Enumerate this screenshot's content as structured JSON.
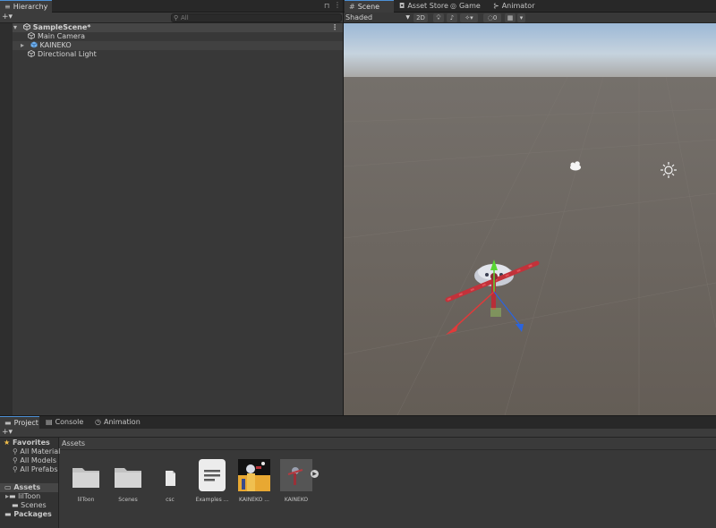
{
  "hierarchy": {
    "tab_label": "Hierarchy",
    "search_placeholder": "All",
    "scene_name": "SampleScene*",
    "items": [
      {
        "label": "Main Camera"
      },
      {
        "label": "KAINEKO"
      },
      {
        "label": "Directional Light"
      }
    ]
  },
  "scene_tabs": [
    {
      "label": "Scene",
      "icon": "grid-icon"
    },
    {
      "label": "Asset Store",
      "icon": "bag-icon"
    },
    {
      "label": "Game",
      "icon": "gamepad-icon"
    },
    {
      "label": "Animator",
      "icon": "animator-icon"
    }
  ],
  "scene_toolbar": {
    "shading_mode": "Shaded",
    "mode_2d": "2D",
    "hidden_count": "0"
  },
  "project": {
    "tabs": [
      {
        "label": "Project",
        "icon": "folder-icon"
      },
      {
        "label": "Console",
        "icon": "console-icon"
      },
      {
        "label": "Animation",
        "icon": "animation-icon"
      }
    ],
    "favorites_label": "Favorites",
    "favorites": [
      {
        "label": "All Material"
      },
      {
        "label": "All Models"
      },
      {
        "label": "All Prefabs"
      }
    ],
    "assets_label": "Assets",
    "asset_folders": [
      {
        "label": "lilToon"
      },
      {
        "label": "Scenes"
      }
    ],
    "packages_label": "Packages",
    "breadcrumb": "Assets",
    "assets": [
      {
        "label": "lilToon",
        "kind": "folder"
      },
      {
        "label": "Scenes",
        "kind": "folder"
      },
      {
        "label": "csc",
        "kind": "file"
      },
      {
        "label": "Examples ...",
        "kind": "text"
      },
      {
        "label": "KAINEKO ...",
        "kind": "texture"
      },
      {
        "label": "KAINEKO",
        "kind": "prefab"
      }
    ]
  },
  "colors": {
    "selection_blue": "#4d90d6",
    "sky_top": "#9ab6d3",
    "ground": "#6e6861",
    "gizmo_x": "#e03a3a",
    "gizmo_y": "#58d633",
    "gizmo_z": "#2a64e0",
    "favorite_star": "#f5c04a"
  }
}
